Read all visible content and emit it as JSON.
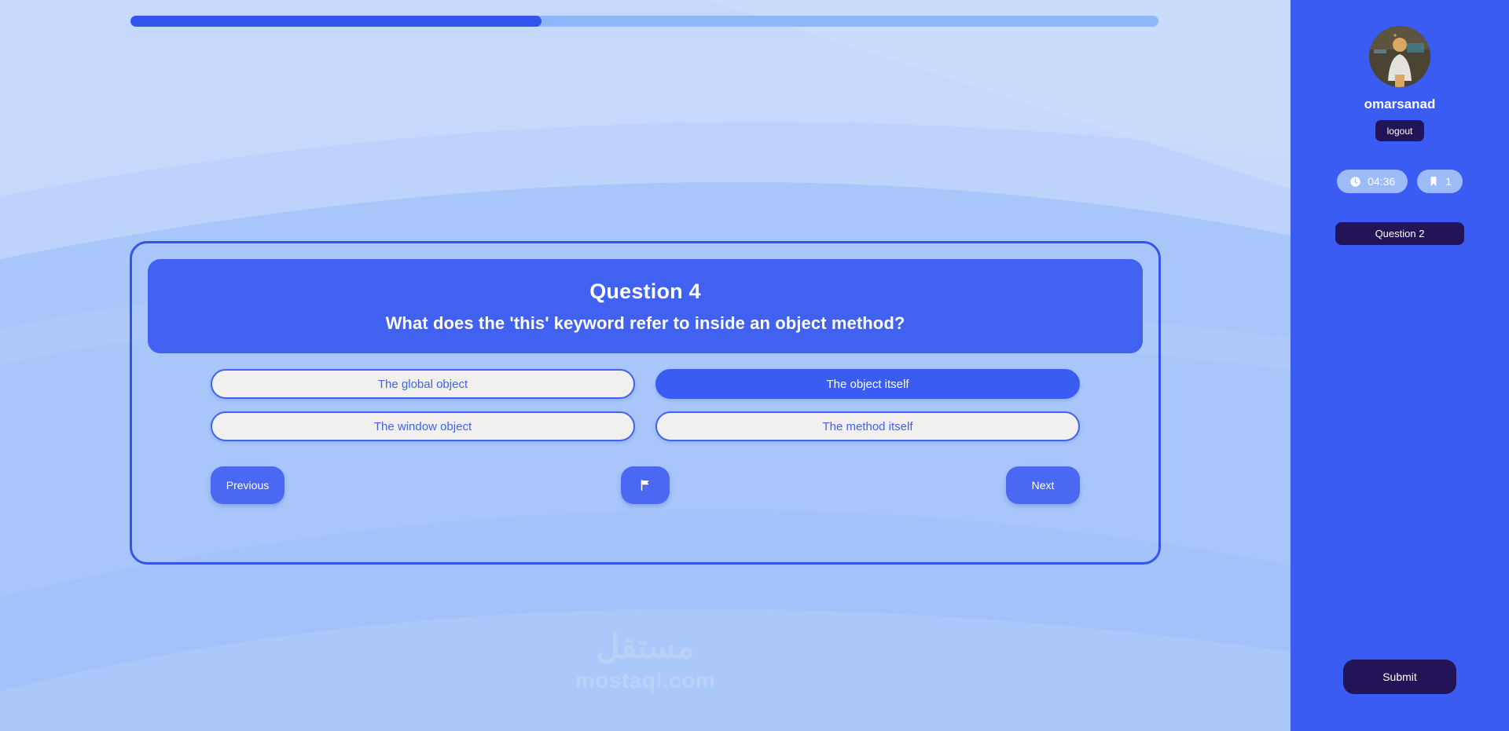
{
  "progress": {
    "percent": 40,
    "label": "40%"
  },
  "question": {
    "title": "Question 4",
    "text": "What does the 'this' keyword refer to inside an object method?",
    "options": [
      {
        "label": "The global object",
        "selected": false
      },
      {
        "label": "The object itself",
        "selected": true
      },
      {
        "label": "The window object",
        "selected": false
      },
      {
        "label": "The method itself",
        "selected": false
      }
    ]
  },
  "navigation": {
    "previous_label": "Previous",
    "next_label": "Next",
    "flag_icon": "flag-icon"
  },
  "sidebar": {
    "avatar_icon": "user-avatar",
    "username": "omarsanad",
    "logout_label": "logout",
    "timer": {
      "icon": "clock-icon",
      "value": "04:36"
    },
    "bookmarks": {
      "icon": "bookmark-icon",
      "count": "1"
    },
    "question_jump_label": "Question 2",
    "submit_label": "Submit"
  },
  "watermark": {
    "arabic": "مستقل",
    "latin": "mostaql.com"
  },
  "colors": {
    "accent": "#3A5CF3",
    "header": "#4162F0",
    "dark": "#221456",
    "background": "#A9C6FA",
    "option_bg": "#F1F0EE",
    "pill": "#9CBBF7"
  }
}
